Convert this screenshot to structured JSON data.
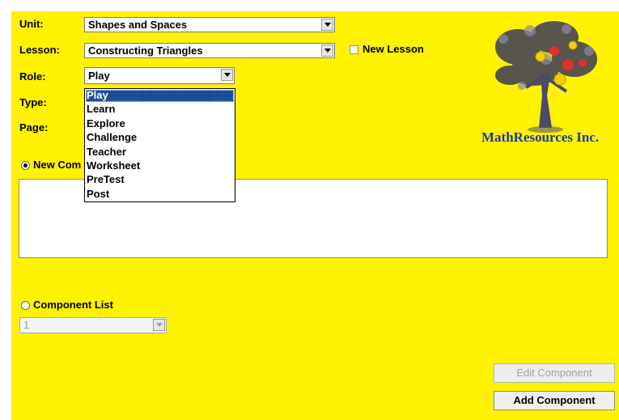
{
  "form": {
    "unit": {
      "label": "Unit:",
      "value": "Shapes and Spaces"
    },
    "lesson": {
      "label": "Lesson:",
      "value": "Constructing Triangles"
    },
    "new_lesson_label": "New Lesson",
    "role": {
      "label": "Role:",
      "value": "Play"
    },
    "type_label": "Type:",
    "page_label": "Page:"
  },
  "role_dropdown": {
    "options": [
      "Play",
      "Learn",
      "Explore",
      "Challenge",
      "Teacher",
      "Worksheet",
      "PreTest",
      "Post"
    ],
    "selected_index": 0
  },
  "new_component": {
    "label": "New Com",
    "selected": true
  },
  "component_list": {
    "label": "Component List",
    "selected": false,
    "value": "1"
  },
  "buttons": {
    "edit_component": "Edit Component",
    "add_component": "Add Component"
  },
  "logo": {
    "text": "MathResources Inc."
  },
  "colors": {
    "background": "#fff200",
    "selection": "#1f4e9a",
    "logo_text": "#1e3aa0"
  }
}
